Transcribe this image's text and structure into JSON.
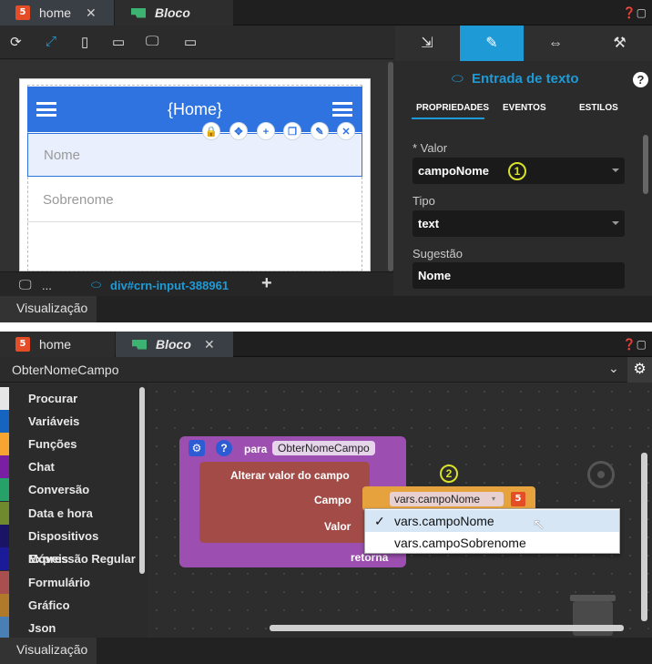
{
  "top": {
    "tabs": [
      {
        "label": "home",
        "active": true
      },
      {
        "label": "Bloco",
        "active": false
      }
    ],
    "breadcrumb_dots": "...",
    "breadcrumb_selector": "div#crn-input-388961",
    "app": {
      "title": "{Home}",
      "fields": [
        {
          "placeholder": "Nome"
        },
        {
          "placeholder": "Sobrenome"
        }
      ]
    },
    "visualization_tab": "Visualização"
  },
  "properties": {
    "title": "Entrada de texto",
    "help": "?",
    "subtabs": [
      "PROPRIEDADES",
      "EVENTOS",
      "ESTILOS"
    ],
    "fields": [
      {
        "label": "* Valor",
        "value": "campoNome",
        "dropdown": true
      },
      {
        "label": "Tipo",
        "value": "text",
        "dropdown": true
      },
      {
        "label": "Sugestão",
        "value": "Nome",
        "dropdown": false
      }
    ],
    "callout1": "1"
  },
  "bottom": {
    "tabs": [
      {
        "label": "home",
        "active": false
      },
      {
        "label": "Bloco",
        "active": true
      }
    ],
    "function_select": "ObterNomeCampo",
    "categories": [
      {
        "label": "Procurar",
        "color": "#e6e6e6"
      },
      {
        "label": "Variáveis",
        "color": "#1565c0"
      },
      {
        "label": "Funções",
        "color": "#f6a531"
      },
      {
        "label": "Chat",
        "color": "#7b1fa2"
      },
      {
        "label": "Conversão",
        "color": "#26a269"
      },
      {
        "label": "Data e hora",
        "color": "#6f8a2e"
      },
      {
        "label": "Dispositivos Móveis",
        "color": "#1b1464"
      },
      {
        "label": "Expressão Regular",
        "color": "#1b1b9a"
      },
      {
        "label": "Formulário",
        "color": "#a94f4f"
      },
      {
        "label": "Gráfico",
        "color": "#b07a2a"
      },
      {
        "label": "Json",
        "color": "#4a7fb5"
      }
    ],
    "block": {
      "para": "para",
      "func_name": "ObterNomeCampo",
      "action": "Alterar valor do campo",
      "campo_label": "Campo",
      "valor_label": "Valor",
      "retorna_label": "retorna",
      "field_value": "vars.campoNome"
    },
    "dropdown_options": [
      {
        "label": "vars.campoNome",
        "selected": true
      },
      {
        "label": "vars.campoSobrenome",
        "selected": false
      }
    ],
    "check": "✓",
    "callout2": "2",
    "visualization_tab": "Visualização"
  }
}
